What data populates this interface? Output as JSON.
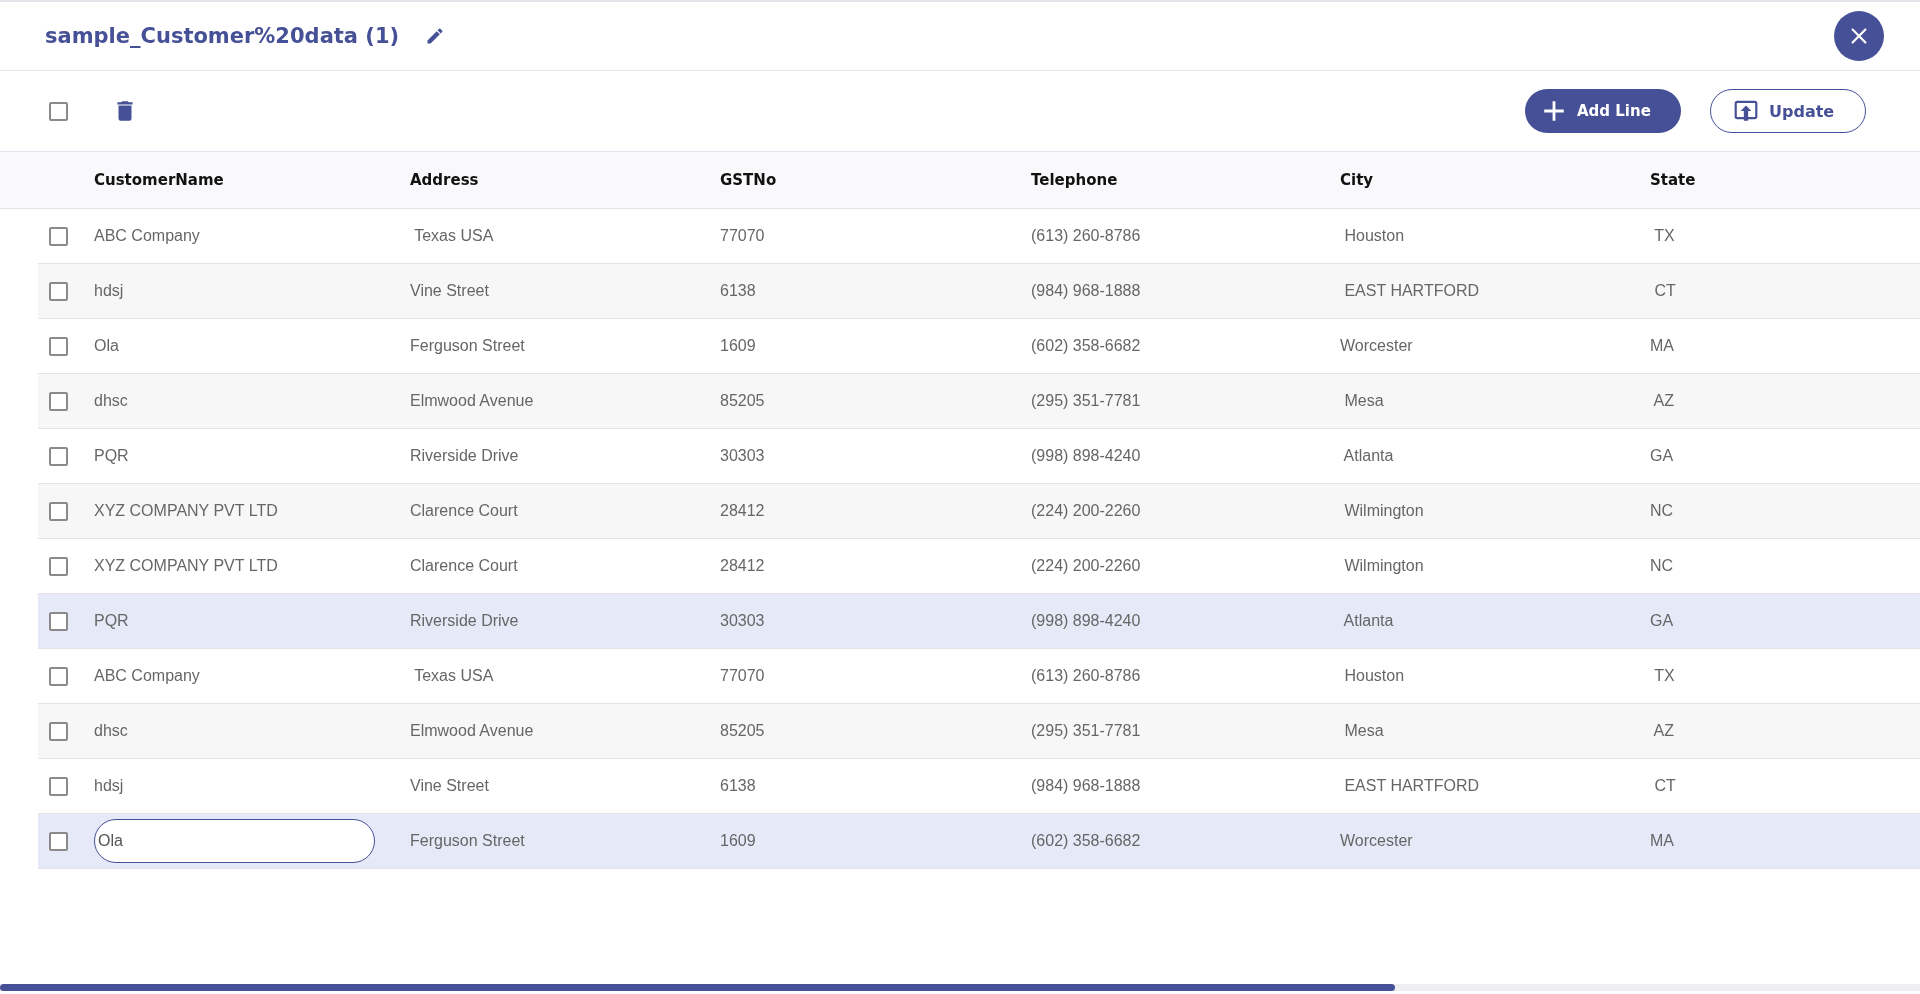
{
  "header": {
    "title": "sample_Customer%20data (1)"
  },
  "toolbar": {
    "select_all": {
      "checked": false
    },
    "buttons": [
      {
        "kind": "add",
        "label": "Add Line"
      },
      {
        "kind": "update",
        "label": "Update"
      }
    ]
  },
  "table": {
    "columns": [
      "CustomerName",
      "Address",
      "GSTNo",
      "Telephone",
      "City",
      "State"
    ],
    "rows": [
      {
        "checked": false,
        "highlighted": false,
        "editing": false,
        "cells": [
          "ABC Company",
          " Texas USA",
          "77070",
          "(613) 260-8786",
          " Houston",
          " TX"
        ]
      },
      {
        "checked": false,
        "highlighted": false,
        "editing": false,
        "cells": [
          "hdsj",
          "Vine Street",
          "6138",
          "(984) 968-1888",
          " EAST HARTFORD",
          " CT"
        ]
      },
      {
        "checked": false,
        "highlighted": false,
        "editing": false,
        "cells": [
          "Ola",
          "Ferguson Street",
          "1609",
          "(602) 358-6682",
          "Worcester",
          "MA"
        ]
      },
      {
        "checked": false,
        "highlighted": false,
        "editing": false,
        "cells": [
          "dhsc",
          "Elmwood Avenue",
          "85205",
          "(295) 351-7781",
          " Mesa",
          " AZ"
        ]
      },
      {
        "checked": false,
        "highlighted": false,
        "editing": false,
        "cells": [
          "PQR",
          "Riverside Drive",
          "30303",
          "(998) 898-4240",
          " Atlanta",
          "GA"
        ]
      },
      {
        "checked": false,
        "highlighted": false,
        "editing": false,
        "cells": [
          "XYZ COMPANY PVT LTD",
          "Clarence Court",
          "28412",
          "(224) 200-2260",
          " Wilmington",
          "NC"
        ]
      },
      {
        "checked": false,
        "highlighted": false,
        "editing": false,
        "cells": [
          "XYZ COMPANY PVT LTD",
          "Clarence Court",
          "28412",
          "(224) 200-2260",
          " Wilmington",
          "NC"
        ]
      },
      {
        "checked": false,
        "highlighted": true,
        "editing": false,
        "cells": [
          "PQR",
          "Riverside Drive",
          "30303",
          "(998) 898-4240",
          " Atlanta",
          "GA"
        ]
      },
      {
        "checked": false,
        "highlighted": false,
        "editing": false,
        "cells": [
          "ABC Company",
          " Texas USA",
          "77070",
          "(613) 260-8786",
          " Houston",
          " TX"
        ]
      },
      {
        "checked": false,
        "highlighted": false,
        "editing": false,
        "cells": [
          "dhsc",
          "Elmwood Avenue",
          "85205",
          "(295) 351-7781",
          " Mesa",
          " AZ"
        ]
      },
      {
        "checked": false,
        "highlighted": false,
        "editing": false,
        "cells": [
          "hdsj",
          "Vine Street",
          "6138",
          "(984) 968-1888",
          " EAST HARTFORD",
          " CT"
        ]
      },
      {
        "checked": false,
        "highlighted": true,
        "editing": true,
        "cells": [
          "Ola",
          "Ferguson Street",
          "1609",
          "(602) 358-6682",
          "Worcester",
          "MA"
        ]
      }
    ]
  }
}
